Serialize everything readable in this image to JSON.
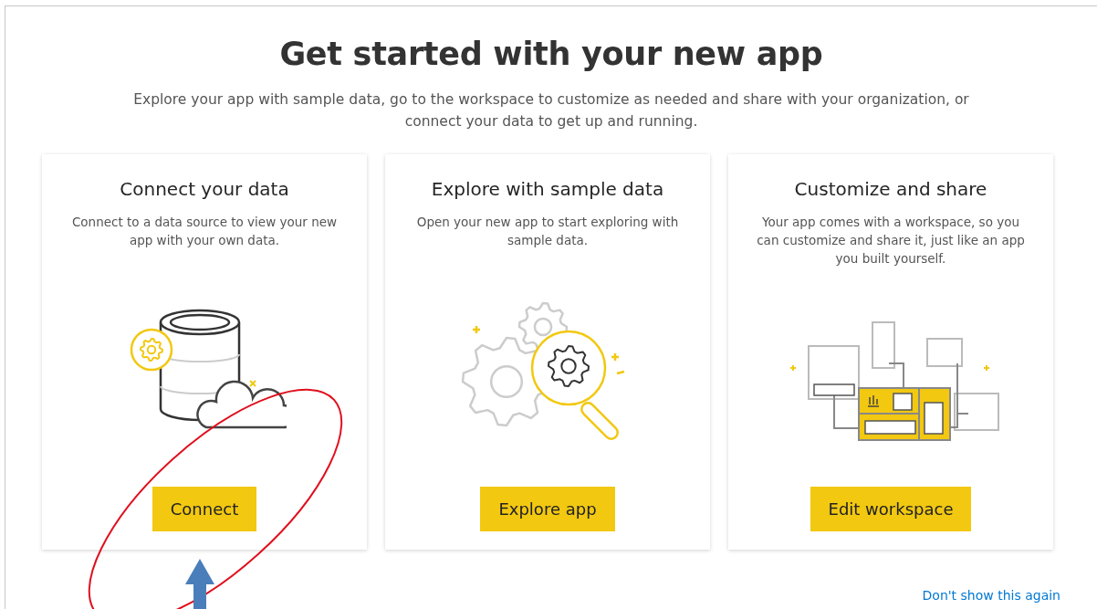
{
  "title": "Get started with your new app",
  "subtitle": "Explore your app with sample data, go to the workspace to customize as needed and share with your organization, or connect your data to get up and running.",
  "cards": [
    {
      "kind": "database",
      "title": "Connect your data",
      "description": "Connect to a data source to view your new app with your own data.",
      "button": "Connect"
    },
    {
      "kind": "magnifier",
      "title": "Explore with sample data",
      "description": "Open your new app to start exploring with sample data.",
      "button": "Explore app"
    },
    {
      "kind": "dashboard",
      "title": "Customize and share",
      "description": "Your app comes with a workspace, so you can customize and share it, just like an app you built yourself.",
      "button": "Edit workspace"
    }
  ],
  "footer_link": "Don't show this again"
}
